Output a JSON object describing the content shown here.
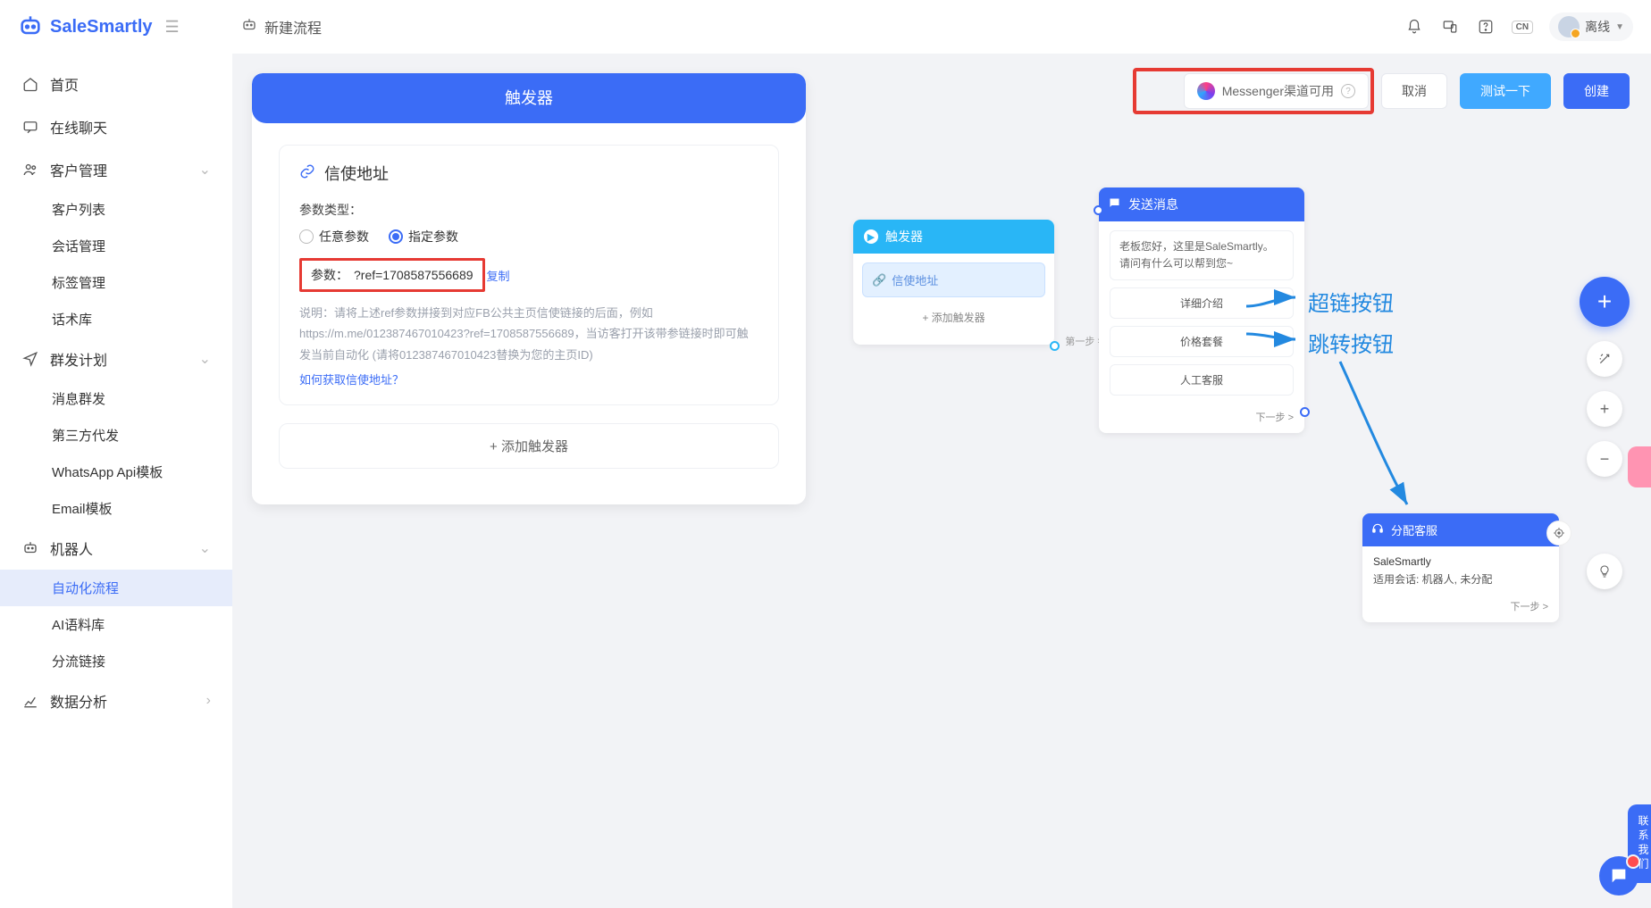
{
  "header": {
    "logo": "SaleSmartly",
    "title": "新建流程",
    "lang_badge": "CN",
    "user_status": "离线"
  },
  "sidebar": {
    "home": "首页",
    "chat": "在线聊天",
    "customer": "客户管理",
    "customer_items": [
      "客户列表",
      "会话管理",
      "标签管理",
      "话术库"
    ],
    "broadcast": "群发计划",
    "broadcast_items": [
      "消息群发",
      "第三方代发",
      "WhatsApp Api模板",
      "Email模板"
    ],
    "bot": "机器人",
    "bot_items": [
      "自动化流程",
      "AI语料库",
      "分流链接"
    ],
    "analytics": "数据分析"
  },
  "trigger": {
    "panel_title": "触发器",
    "sub_title": "信使地址",
    "param_type_label": "参数类型：",
    "radio_any": "任意参数",
    "radio_spec": "指定参数",
    "param_label": "参数：",
    "param_value": "?ref=1708587556689",
    "copy": "复制",
    "desc": "说明：请将上述ref参数拼接到对应FB公共主页信使链接的后面，例如https://m.me/012387467010423?ref=1708587556689，当访客打开该带参链接时即可触发当前自动化 (请将012387467010423替换为您的主页ID)",
    "howto": "如何获取信使地址？",
    "add_trigger": "+ 添加触发器"
  },
  "actions": {
    "channel": "Messenger渠道可用",
    "cancel": "取消",
    "test": "测试一下",
    "create": "创建"
  },
  "flow": {
    "trigger_title": "触发器",
    "trigger_item": "信使地址",
    "trigger_add": "+ 添加触发器",
    "step1": "第一步",
    "msg_title": "发送消息",
    "msg_text": "老板您好，这里是SaleSmartly。请问有什么可以帮到您~",
    "msg_btns": [
      "详细介绍",
      "价格套餐",
      "人工客服"
    ],
    "next": "下一步 >",
    "assign_title": "分配客服",
    "assign_name": "SaleSmartly",
    "assign_desc": "适用会话: 机器人, 未分配"
  },
  "annotations": {
    "hyperlink_btn": "超链按钮",
    "jump_btn": "跳转按钮"
  },
  "side": {
    "contact": "联系我们"
  },
  "tools": {
    "magic": "✦",
    "plus": "+",
    "minus": "−",
    "bulb": "💡"
  }
}
